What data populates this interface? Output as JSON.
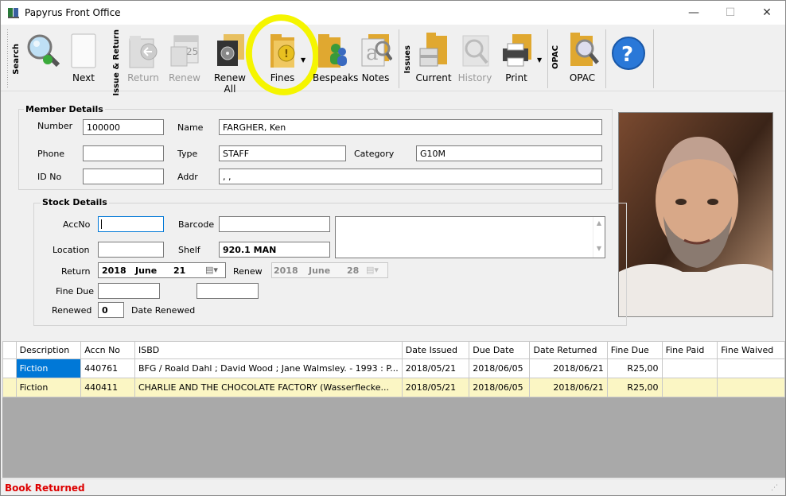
{
  "window": {
    "title": "Papyrus Front Office",
    "minimize": "—",
    "maximize": "☐",
    "close": "✕"
  },
  "toolbar": {
    "groups": {
      "search": "Search",
      "issue_return": "Issue & Return",
      "issues": "Issues",
      "opac": "OPAC"
    },
    "buttons": {
      "next": "Next",
      "return": "Return",
      "renew": "Renew",
      "renew_all": "Renew All",
      "fines": "Fines",
      "bespeaks": "Bespeaks",
      "notes": "Notes",
      "current": "Current",
      "history": "History",
      "print": "Print",
      "opac": "OPAC"
    },
    "calendar_day": "25",
    "highlight_color": "#f5f500"
  },
  "member": {
    "group_title": "Member Details",
    "number_label": "Number",
    "number": "100000",
    "name_label": "Name",
    "name": "FARGHER, Ken",
    "phone_label": "Phone",
    "phone": "",
    "type_label": "Type",
    "type": "STAFF",
    "category_label": "Category",
    "category": "G10M",
    "idno_label": "ID No",
    "idno": "",
    "addr_label": "Addr",
    "addr": ", ,"
  },
  "stock": {
    "group_title": "Stock Details",
    "accno_label": "AccNo",
    "accno": "",
    "barcode_label": "Barcode",
    "barcode": "",
    "location_label": "Location",
    "location": "",
    "shelf_label": "Shelf",
    "shelf": "920.1 MAN",
    "return_label": "Return",
    "return_year": "2018",
    "return_month": "June",
    "return_day": "21",
    "renew_label": "Renew",
    "renew_year": "2018",
    "renew_month": "June",
    "renew_day": "28",
    "fine_due_label": "Fine Due",
    "fine_due": "",
    "fine_due_extra": "",
    "renewed_label": "Renewed",
    "renewed": "0",
    "date_renewed_label": "Date Renewed"
  },
  "table": {
    "columns": [
      "Description",
      "Accn No",
      "ISBD",
      "Date Issued",
      "Due Date",
      "Date Returned",
      "Fine Due",
      "Fine Paid",
      "Fine Waived"
    ],
    "rows": [
      [
        "Fiction",
        "440761",
        "BFG / Roald Dahl ; David Wood ; Jane Walmsley. - 1993 : P...",
        "2018/05/21",
        "2018/06/05",
        "2018/06/21",
        "R25,00",
        "",
        ""
      ],
      [
        "Fiction",
        "440411",
        "CHARLIE AND THE CHOCOLATE FACTORY (Wasserflecke...",
        "2018/05/21",
        "2018/06/05",
        "2018/06/21",
        "R25,00",
        "",
        ""
      ]
    ]
  },
  "status": {
    "message": "Book Returned",
    "color": "#dd0000"
  }
}
